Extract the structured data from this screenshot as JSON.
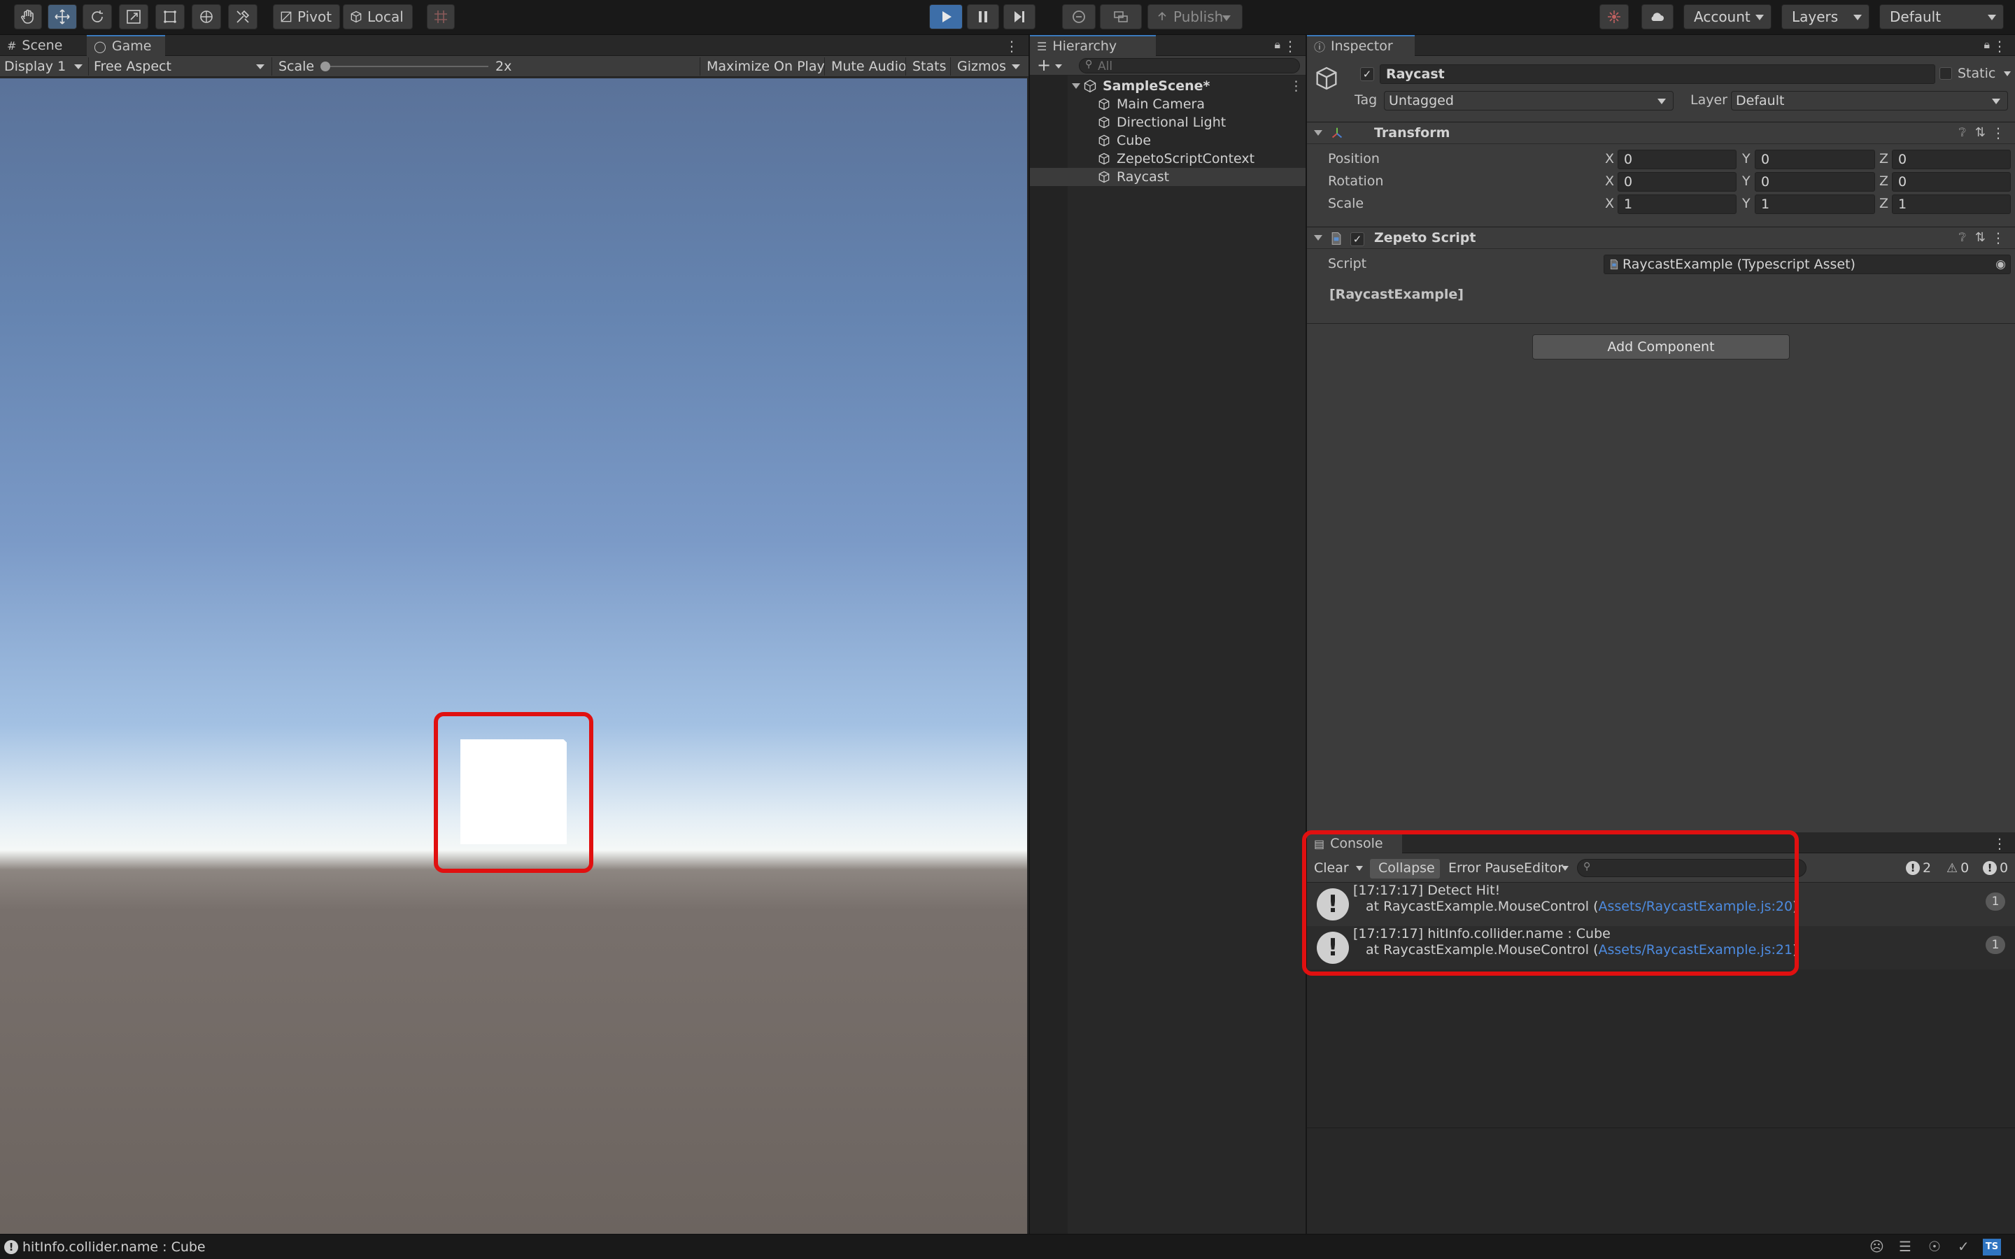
{
  "toolbar": {
    "pivot": "Pivot",
    "local": "Local",
    "publish": "Publish",
    "account": "Account",
    "layers": "Layers",
    "layout": "Default"
  },
  "game": {
    "tabs": [
      "Scene",
      "Game"
    ],
    "display": "Display 1",
    "aspect": "Free Aspect",
    "scale_label": "Scale",
    "scale_value": "2x",
    "maximize": "Maximize On Play",
    "mute": "Mute Audio",
    "stats": "Stats",
    "gizmos": "Gizmos"
  },
  "hierarchy": {
    "title": "Hierarchy",
    "search_placeholder": "All",
    "scene": "SampleScene*",
    "items": [
      "Main Camera",
      "Directional Light",
      "Cube",
      "ZepetoScriptContext",
      "Raycast"
    ]
  },
  "inspector": {
    "title": "Inspector",
    "object_name": "Raycast",
    "static_label": "Static",
    "tag_label": "Tag",
    "tag_value": "Untagged",
    "layer_label": "Layer",
    "layer_value": "Default",
    "transform": {
      "title": "Transform",
      "position_label": "Position",
      "rotation_label": "Rotation",
      "scale_label": "Scale",
      "position": [
        "0",
        "0",
        "0"
      ],
      "rotation": [
        "0",
        "0",
        "0"
      ],
      "scale": [
        "1",
        "1",
        "1"
      ]
    },
    "zepeto": {
      "title": "Zepeto Script",
      "script_label": "Script",
      "script_value": "RaycastExample (Typescript Asset)",
      "class_label": "[RaycastExample]"
    },
    "add_component": "Add Component"
  },
  "console": {
    "title": "Console",
    "clear": "Clear",
    "collapse": "Collapse",
    "error_pause": "Error Pause",
    "editor": "Editor",
    "count_info": "2",
    "count_warn": "0",
    "count_error": "0",
    "entries": [
      {
        "line1": "[17:17:17] Detect Hit!",
        "prefix": "at RaycastExample.MouseControl (",
        "link": "Assets/RaycastExample.js:20",
        "suffix": ")",
        "count": "1"
      },
      {
        "line1": "[17:17:17] hitInfo.collider.name : Cube",
        "prefix": "at RaycastExample.MouseControl (",
        "link": "Assets/RaycastExample.js:21",
        "suffix": ")",
        "count": "1"
      }
    ]
  },
  "status": {
    "message": "hitInfo.collider.name : Cube",
    "badge": "TS"
  },
  "colors": {
    "highlight": "#e01010",
    "link": "#4d8be0",
    "play_active": "#46607c"
  }
}
